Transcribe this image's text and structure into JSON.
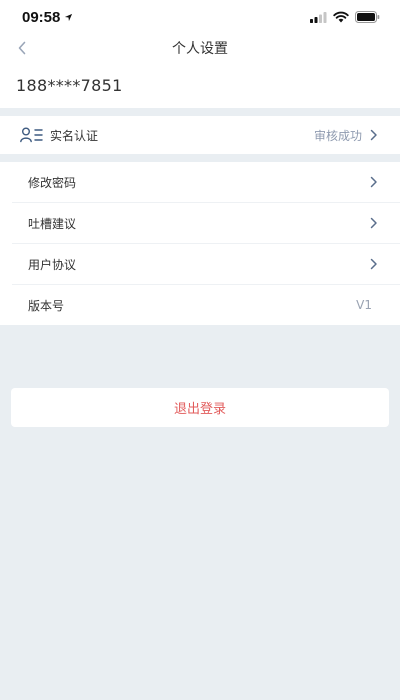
{
  "status_bar": {
    "time": "09:58"
  },
  "nav": {
    "title": "个人设置"
  },
  "account": {
    "phone": "188****7851"
  },
  "verification": {
    "label": "实名认证",
    "status": "审核成功"
  },
  "settings": {
    "items": [
      {
        "label": "修改密码"
      },
      {
        "label": "吐槽建议"
      },
      {
        "label": "用户协议"
      }
    ],
    "version_label": "版本号",
    "version_value": "V1"
  },
  "logout": {
    "label": "退出登录"
  },
  "colors": {
    "background": "#e9eef2",
    "logout_text": "#e25c5c",
    "secondary_text": "#8f9bb0"
  },
  "icons": {
    "location": "location-arrow-icon",
    "signal": "signal-icon",
    "wifi": "wifi-icon",
    "battery": "battery-icon",
    "back": "chevron-left-icon",
    "user_list": "user-list-icon",
    "chevron": "chevron-right-icon"
  }
}
